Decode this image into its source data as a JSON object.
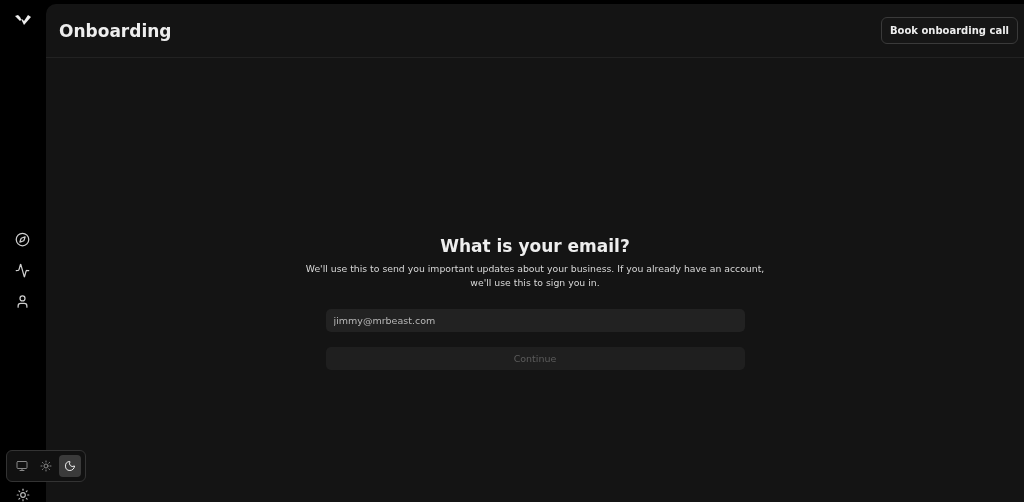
{
  "header": {
    "title": "Onboarding",
    "action": "Book onboarding call"
  },
  "sidebar": {
    "items": [
      {
        "kind": "explore"
      },
      {
        "kind": "analytics"
      },
      {
        "kind": "profile"
      }
    ]
  },
  "form": {
    "heading": "What is your email?",
    "description": "We'll use this to send you important updates about your business. If you already have an account, we'll use this to sign you in.",
    "email": {
      "placeholder": "jimmy@mrbeast.com"
    },
    "submit": {
      "label": "Continue",
      "disabled": true
    }
  },
  "theme_switcher": {
    "options": [
      {
        "kind": "system",
        "selected": false
      },
      {
        "kind": "light",
        "selected": false
      },
      {
        "kind": "dark",
        "selected": true
      }
    ]
  }
}
